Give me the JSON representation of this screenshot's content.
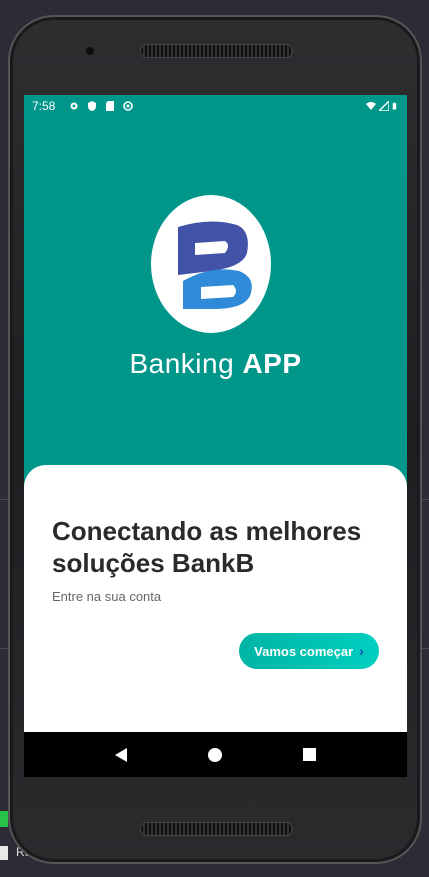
{
  "status_bar": {
    "time": "7:58",
    "left_icons": [
      "settings-icon",
      "shield-icon",
      "sd-card-icon",
      "at-icon"
    ],
    "right_icons": [
      "wifi-icon",
      "signal-icon",
      "battery-icon"
    ]
  },
  "app": {
    "brand_light": "Banking ",
    "brand_bold": "APP",
    "headline": "Conectando as melhores soluções BankB",
    "subtitle": "Entre na sua conta",
    "cta_label": "Vamos começar",
    "cta_icon": "chevron-right-icon",
    "accent_color": "#00968a",
    "button_color": "#00c2b2"
  },
  "background": {
    "bottom_left_text": "Ru"
  },
  "nav": {
    "buttons": [
      "back-icon",
      "home-icon",
      "recents-icon"
    ]
  }
}
